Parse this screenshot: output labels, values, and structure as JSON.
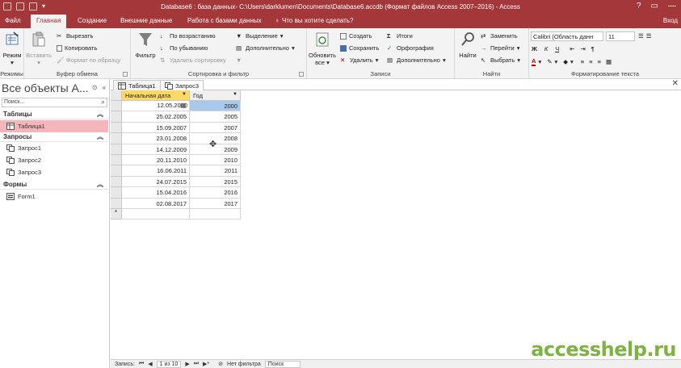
{
  "window": {
    "title": "Database6 : база данных- C:\\Users\\darklumen\\Documents\\Database6.accdb (Формат файлов Access 2007–2016) - Access",
    "sign_in": "Вход",
    "help": "?",
    "minimize": "—"
  },
  "ribbon_tabs": {
    "file": "Файл",
    "home": "Главная",
    "create": "Создание",
    "external": "Внешние данные",
    "database": "Работа с базами данных",
    "tell_me": "Что вы хотите сделать?"
  },
  "ribbon": {
    "views": {
      "label": "Режимы",
      "view_button": "Режим"
    },
    "clipboard": {
      "label": "Буфер обмена",
      "paste": "Вставить",
      "cut": "Вырезать",
      "copy": "Копировать",
      "format_painter": "Формат по образцу"
    },
    "sort_filter": {
      "label": "Сортировка и фильтр",
      "filter": "Фильтр",
      "ascending": "По возрастанию",
      "descending": "По убыванию",
      "remove_sort": "Удалить сортировку",
      "selection": "Выделение",
      "advanced": "Дополнительно",
      "toggle_filter": ""
    },
    "records": {
      "label": "Записи",
      "refresh": "Обновить",
      "refresh_sub": "все",
      "new": "Создать",
      "save": "Сохранить",
      "delete": "Удалить",
      "totals": "Итоги",
      "spelling": "Орфография",
      "more": "Дополнительно"
    },
    "find": {
      "label": "Найти",
      "find": "Найти",
      "replace": "Заменить",
      "goto": "Перейти",
      "select": "Выбрать"
    },
    "text_formatting": {
      "label": "Форматирование текста",
      "font": "Calibri (Область данн",
      "size": "11",
      "bold": "Ж",
      "italic": "К",
      "underline": "Ч",
      "font_color": "A"
    }
  },
  "nav_pane": {
    "title": "Все объекты A...",
    "search_placeholder": "Поиск...",
    "groups": {
      "tables": {
        "label": "Таблицы",
        "items": [
          "Таблица1"
        ]
      },
      "queries": {
        "label": "Запросы",
        "items": [
          "Запрос1",
          "Запрос2",
          "Запрос3"
        ]
      },
      "forms": {
        "label": "Формы",
        "items": [
          "Form1"
        ]
      }
    }
  },
  "doc_tabs": [
    "Таблица1",
    "Запрос3"
  ],
  "datasheet": {
    "columns": [
      "Начальная дата",
      "Год"
    ],
    "rows": [
      [
        "12.05.2000",
        "2000"
      ],
      [
        "25.02.2005",
        "2005"
      ],
      [
        "15.09.2007",
        "2007"
      ],
      [
        "23.01.2008",
        "2008"
      ],
      [
        "14.12.2009",
        "2009"
      ],
      [
        "20.11.2010",
        "2010"
      ],
      [
        "16.06.2011",
        "2011"
      ],
      [
        "24.07.2015",
        "2015"
      ],
      [
        "15.04.2016",
        "2016"
      ],
      [
        "02.08.2017",
        "2017"
      ]
    ],
    "new_row_marker": "*"
  },
  "status_bar": {
    "record_label": "Запись:",
    "record_position": "1 из 10",
    "filter_state": "Нет фильтра",
    "search": "Поиск"
  },
  "watermark": "accesshelp.ru",
  "colors": {
    "accent": "#a4373a",
    "ribbon_bg": "#f3f3f3",
    "selected_nav": "#f4b6bb",
    "header_highlight": "#ffd966",
    "year_highlight": "#a8c8ec",
    "watermark": "#7cb342"
  }
}
